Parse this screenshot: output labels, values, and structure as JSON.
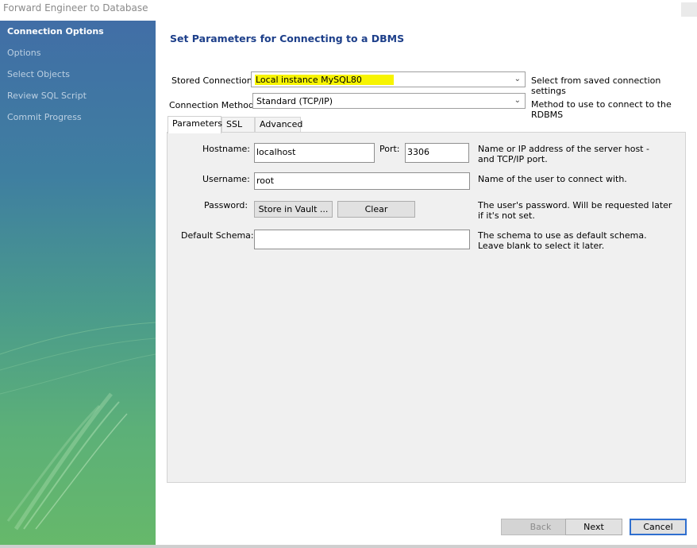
{
  "window": {
    "title": "Forward Engineer to Database"
  },
  "sidebar": {
    "items": [
      {
        "label": "Connection Options",
        "active": true
      },
      {
        "label": "Options",
        "active": false
      },
      {
        "label": "Select Objects",
        "active": false
      },
      {
        "label": "Review SQL Script",
        "active": false
      },
      {
        "label": "Commit Progress",
        "active": false
      }
    ]
  },
  "main": {
    "heading": "Set Parameters for Connecting to a DBMS",
    "stored_connection": {
      "label": "Stored Connection:",
      "value": "Local instance MySQL80",
      "description": "Select from saved connection settings"
    },
    "connection_method": {
      "label": "Connection Method:",
      "value": "Standard (TCP/IP)",
      "description": "Method to use to connect to the RDBMS"
    },
    "tabs": [
      {
        "label": "Parameters",
        "active": true
      },
      {
        "label": "SSL",
        "active": false
      },
      {
        "label": "Advanced",
        "active": false
      }
    ],
    "parameters": {
      "hostname": {
        "label": "Hostname:",
        "value": "localhost"
      },
      "port": {
        "label": "Port:",
        "value": "3306"
      },
      "hostname_description": "Name or IP address of the server host - and TCP/IP port.",
      "username": {
        "label": "Username:",
        "value": "root",
        "description": "Name of the user to connect with."
      },
      "password": {
        "label": "Password:",
        "store_button": "Store in Vault ...",
        "clear_button": "Clear",
        "description": "The user's password. Will be requested later if it's not set."
      },
      "default_schema": {
        "label": "Default Schema:",
        "value": "",
        "description": "The schema to use as default schema. Leave blank to select it later."
      }
    }
  },
  "footer": {
    "back": "Back",
    "next": "Next",
    "cancel": "Cancel"
  },
  "colors": {
    "heading": "#1d3f8a",
    "highlight": "#f7f400",
    "default_button_border": "#2f6fcf"
  },
  "icons": {
    "dropdown": "chevron-down-icon"
  }
}
